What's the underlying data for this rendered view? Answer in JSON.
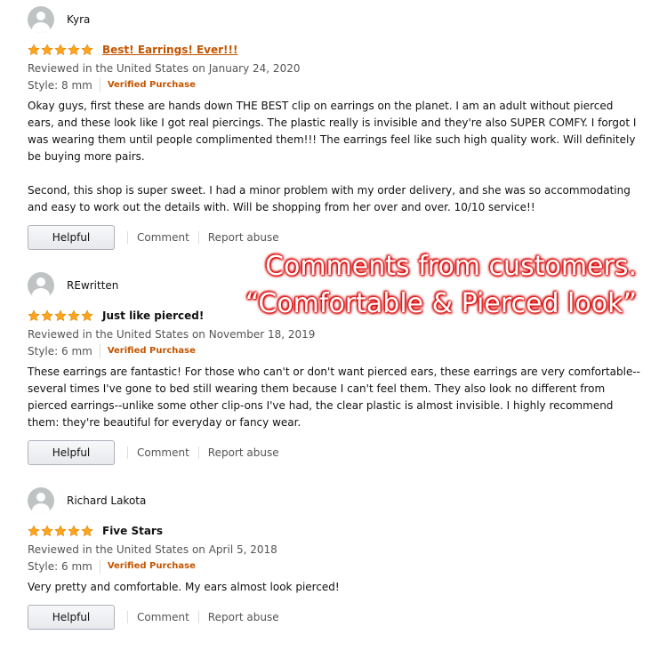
{
  "reviews": [
    {
      "username": "Kyra",
      "rating": 5,
      "title": "Best! Earrings! Ever!!!",
      "date_line": "Reviewed in the United States on January 24, 2020",
      "style": "Style: 8 mm",
      "verified": "Verified Purchase",
      "body": "Okay guys, first these are hands down THE BEST clip on earrings on the planet. I am an adult without pierced ears, and these look like I got real piercings. The plastic really is invisible and they're also SUPER COMFY. I forgot I was wearing them until people complimented them!!! The earrings feel like such high quality work. Will definitely be buying more pairs.\n\nSecond, this shop is super sweet. I had a minor problem with my order delivery, and she was so accommodating and easy to work out the details with. Will be shopping from her over and over. 10/10 service!!",
      "helpful": "Helpful",
      "comment": "Comment",
      "report": "Report abuse"
    },
    {
      "username": "REwritten",
      "rating": 5,
      "title": "Just like pierced!",
      "date_line": "Reviewed in the United States on November 18, 2019",
      "style": "Style: 6 mm",
      "verified": "Verified Purchase",
      "body": "These earrings are fantastic! For those who can't or don't want pierced ears, these earrings are very comfortable-- several times I've gone to bed still wearing them because I can't feel them. They also look no different from pierced earrings--unlike some other clip-ons I've had, the clear plastic is almost invisible. I highly recommend them: they're beautiful for everyday or fancy wear.",
      "helpful": "Helpful",
      "comment": "Comment",
      "report": "Report abuse"
    },
    {
      "username": "Richard Lakota",
      "rating": 5,
      "title": "Five Stars",
      "date_line": "Reviewed in the United States on April 5, 2018",
      "style": "Style: 6 mm",
      "verified": "Verified Purchase",
      "body": "Very pretty and comfortable. My ears almost look pierced!",
      "helpful": "Helpful",
      "comment": "Comment",
      "report": "Report abuse"
    }
  ],
  "overlay": {
    "line1": "Comments from customers.",
    "line2": "“Comfortable & Pierced look”"
  },
  "colors": {
    "star": "#ffa41c",
    "link_orange": "#c45500",
    "overlay_glow": "#e00000"
  }
}
